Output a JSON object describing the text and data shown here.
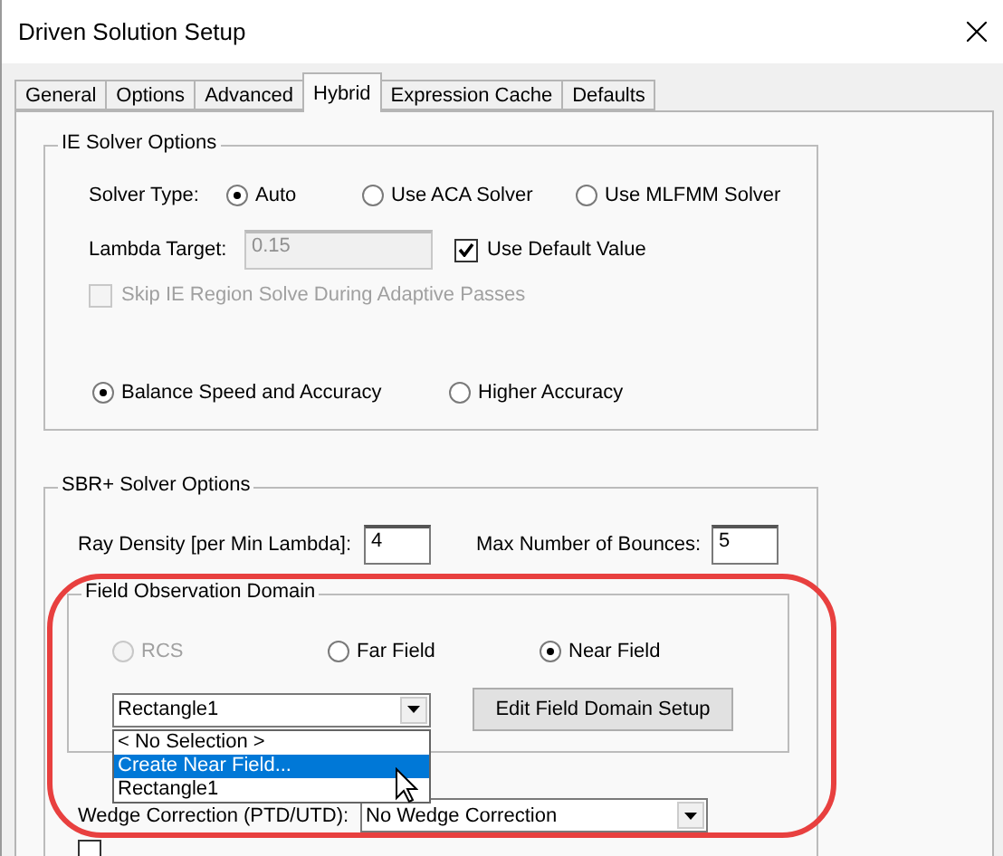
{
  "window": {
    "title": "Driven Solution Setup"
  },
  "tabs": [
    {
      "label": "General",
      "selected": false
    },
    {
      "label": "Options",
      "selected": false
    },
    {
      "label": "Advanced",
      "selected": false
    },
    {
      "label": "Hybrid",
      "selected": true
    },
    {
      "label": "Expression Cache",
      "selected": false
    },
    {
      "label": "Defaults",
      "selected": false
    }
  ],
  "ie_solver_options": {
    "title": "IE Solver Options",
    "solver_type": {
      "label": "Solver Type:",
      "options": [
        {
          "label": "Auto",
          "selected": true
        },
        {
          "label": "Use ACA Solver",
          "selected": false
        },
        {
          "label": "Use MLFMM Solver",
          "selected": false
        }
      ]
    },
    "lambda_target": {
      "label": "Lambda Target:",
      "value": "0.15",
      "disabled": true
    },
    "use_default": {
      "label": "Use Default Value",
      "checked": true
    },
    "skip_ie": {
      "label": "Skip IE Region Solve During Adaptive Passes",
      "checked": false,
      "disabled": true
    },
    "accuracy": [
      {
        "label": "Balance Speed and Accuracy",
        "selected": true
      },
      {
        "label": "Higher Accuracy",
        "selected": false
      }
    ]
  },
  "sbr_solver_options": {
    "title": "SBR+ Solver Options",
    "ray_density": {
      "label": "Ray Density [per Min Lambda]:",
      "value": "4"
    },
    "max_bounces": {
      "label": "Max Number of Bounces:",
      "value": "5"
    },
    "field_observation_domain": {
      "title": "Field Observation Domain",
      "options": [
        {
          "label": "RCS",
          "selected": false,
          "disabled": true
        },
        {
          "label": "Far Field",
          "selected": false,
          "disabled": false
        },
        {
          "label": "Near Field",
          "selected": true,
          "disabled": false
        }
      ],
      "combo": {
        "value": "Rectangle1"
      },
      "edit_button": "Edit Field Domain Setup",
      "dropdown_items": [
        {
          "label": "< No Selection >",
          "selected": false
        },
        {
          "label": "Create Near Field...",
          "selected": true
        },
        {
          "label": "Rectangle1",
          "selected": false
        }
      ]
    },
    "wedge_correction": {
      "label": "Wedge Correction (PTD/UTD):",
      "value": "No Wedge Correction"
    },
    "bottom_checkbox": {
      "checked": false
    }
  }
}
